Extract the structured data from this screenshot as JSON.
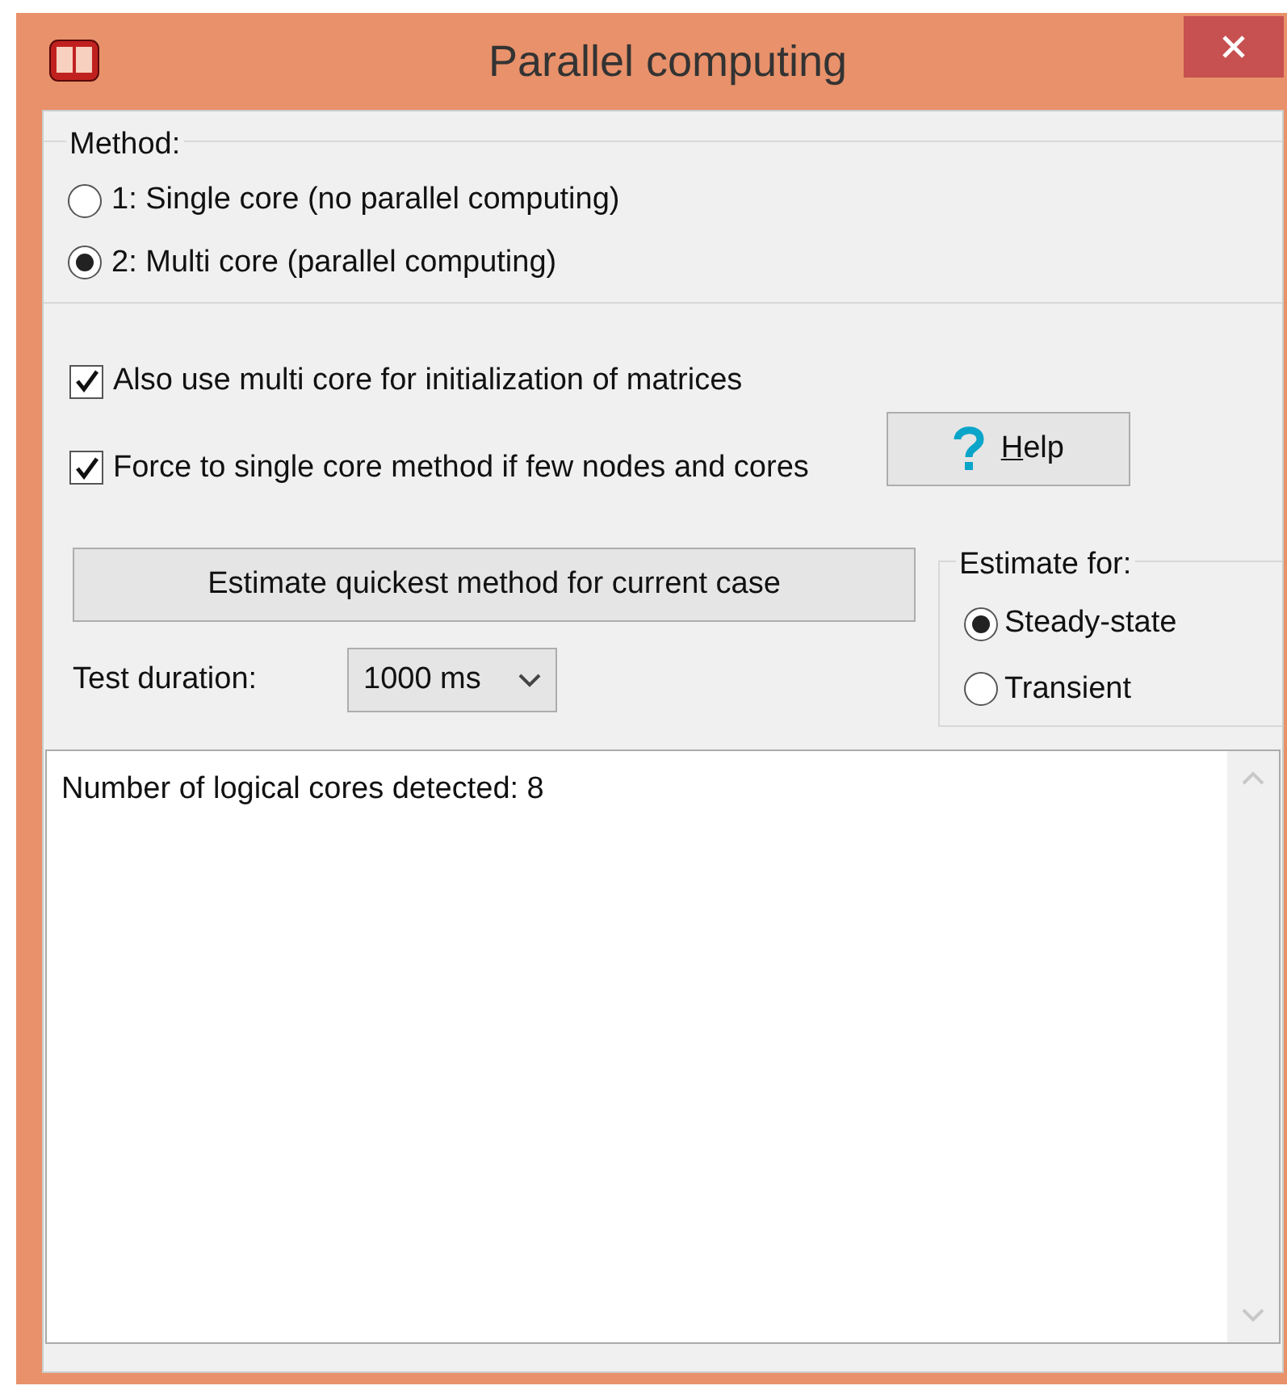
{
  "window": {
    "title": "Parallel computing"
  },
  "method": {
    "label": "Method:",
    "options": [
      {
        "label": "1: Single core (no parallel computing)",
        "selected": false
      },
      {
        "label": "2: Multi core (parallel computing)",
        "selected": true
      }
    ]
  },
  "options": [
    {
      "label": "Also use multi core for initialization of matrices",
      "checked": true
    },
    {
      "label": "Force to single core method if few nodes and cores",
      "checked": true
    }
  ],
  "help_button": {
    "label": "Help"
  },
  "estimate_button": {
    "label": "Estimate quickest method for current case"
  },
  "test_duration": {
    "label": "Test duration:",
    "value": "1000 ms"
  },
  "estimate_for": {
    "label": "Estimate for:",
    "options": [
      {
        "label": "Steady-state",
        "selected": true
      },
      {
        "label": "Transient",
        "selected": false
      }
    ]
  },
  "output": {
    "lines": [
      "Number of logical cores detected: 8"
    ]
  }
}
